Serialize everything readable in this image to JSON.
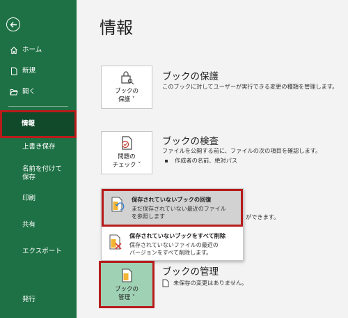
{
  "sidebar": {
    "home": "ホーム",
    "new": "新規",
    "open": "開く",
    "info": "情報",
    "save": "上書き保存",
    "save_as": "名前を付けて保存",
    "print": "印刷",
    "share": "共有",
    "export": "エクスポート",
    "publish": "発行"
  },
  "main": {
    "title": "情報",
    "protect": {
      "tile_label_1": "ブックの",
      "tile_label_2": "保護 ˅",
      "title": "ブックの保護",
      "desc": "このブックに対してユーザーが実行できる変更の種類を管理します。"
    },
    "inspect": {
      "tile_label_1": "問題の",
      "tile_label_2": "チェック ˅",
      "title": "ブックの検査",
      "desc": "ファイルを公開する前に、ファイルの次の項目を確認します。",
      "bullet": "作成者の名前、絶対パス"
    },
    "overflow_text": "ができます。",
    "manage": {
      "tile_label_1": "ブックの",
      "tile_label_2": "管理 ˅",
      "title": "ブックの管理",
      "desc": "未保存の変更はありません。"
    }
  },
  "dropdown": {
    "recover": {
      "title": "保存されていないブックの回復",
      "desc_1": "まだ保存されていない最近のファイル",
      "desc_2": "を参照します"
    },
    "delete_all": {
      "title": "保存されていないブックをすべて削除",
      "desc_1": "保存されていないファイルの最近の",
      "desc_2": "バージョンをすべて削除します。"
    }
  },
  "colors": {
    "sidebar_bg": "#1e7145",
    "highlight_border": "#b81b1b",
    "manage_tile_bg": "#9fd1b4"
  }
}
